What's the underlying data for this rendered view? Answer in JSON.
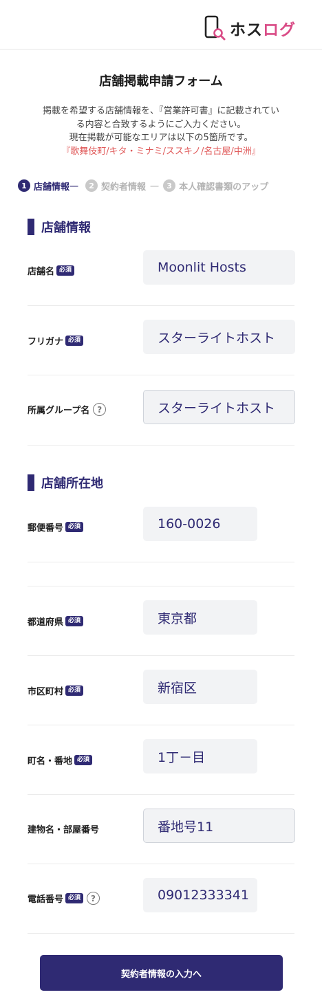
{
  "header": {
    "logo_text_a": "ホス",
    "logo_text_b": "ログ"
  },
  "page_title": "店舗掲載申請フォーム",
  "intro": {
    "line1": "掲載を希望する店舗情報を、『営業許可書』に記載されてい",
    "line2": "る内容と合致するようにご入力ください。",
    "line3": "現在掲載が可能なエリアは以下の5箇所です。",
    "areas": "『歌舞伎町/キタ・ミナミ/ススキノ/名古屋/中洲』"
  },
  "steps": [
    {
      "num": "1",
      "label": "店舗情報"
    },
    {
      "num": "2",
      "label": "契約者情報"
    },
    {
      "num": "3",
      "label": "本人確認書類のアップ"
    }
  ],
  "sections": {
    "store_info": "店舗情報",
    "store_location": "店舗所在地"
  },
  "required_badge": "必須",
  "help_icon": "?",
  "fields": {
    "store_name": {
      "label": "店舗名",
      "value": "Moonlit Hosts"
    },
    "furigana": {
      "label": "フリガナ",
      "value": "スターライトホスト"
    },
    "group_name": {
      "label": "所属グループ名",
      "value": "スターライトホスト"
    },
    "postal_code": {
      "label": "郵便番号",
      "value": "160-0026"
    },
    "prefecture": {
      "label": "都道府県",
      "value": "東京都"
    },
    "city": {
      "label": "市区町村",
      "value": "新宿区"
    },
    "town": {
      "label": "町名・番地",
      "value": "1丁－目"
    },
    "building": {
      "label": "建物名・部屋番号",
      "value": "番地号11"
    },
    "phone": {
      "label": "電話番号",
      "value": "09012333341"
    }
  },
  "submit_label": "契約者情報の入力へ",
  "colors": {
    "primary": "#2f2a73",
    "accent_pink": "#d94b86",
    "area_red": "#e05a5a",
    "field_bg": "#f2f3f5"
  }
}
